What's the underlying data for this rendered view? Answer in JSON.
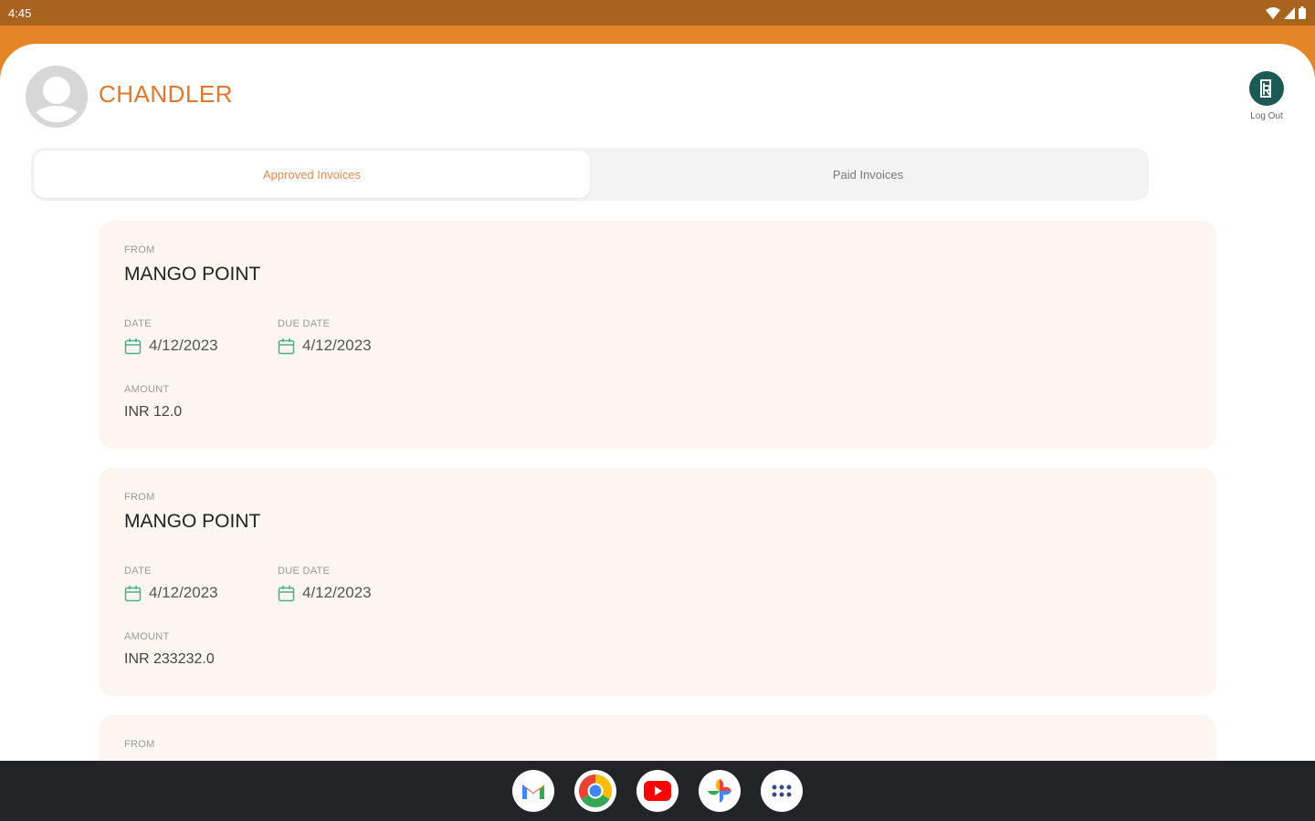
{
  "status_bar": {
    "time": "4:45"
  },
  "user": {
    "name": "CHANDLER"
  },
  "logout": {
    "label": "Log Out"
  },
  "tabs": [
    {
      "label": "Approved Invoices",
      "active": true
    },
    {
      "label": "Paid Invoices",
      "active": false
    }
  ],
  "labels": {
    "from": "FROM",
    "date": "DATE",
    "due_date": "DUE DATE",
    "amount": "AMOUNT"
  },
  "invoices": [
    {
      "from": "MANGO POINT",
      "date": "4/12/2023",
      "due_date": "4/12/2023",
      "amount": "INR 12.0"
    },
    {
      "from": "MANGO POINT",
      "date": "4/12/2023",
      "due_date": "4/12/2023",
      "amount": "INR 233232.0"
    }
  ],
  "colors": {
    "status_bar": "#a8631e",
    "brand_orange": "#e58526",
    "accent_text": "#e0782c",
    "card_bg": "#fdf5ef",
    "logout_icon": "#1e5a55",
    "calendar_icon": "#4caf8c"
  },
  "dock": [
    "gmail-icon",
    "chrome-icon",
    "youtube-icon",
    "photos-icon",
    "app-drawer-icon"
  ]
}
